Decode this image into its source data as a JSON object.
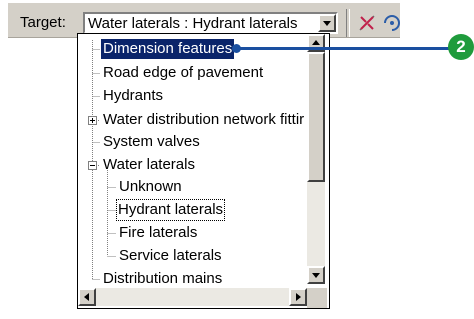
{
  "toolbar": {
    "target_label": "Target:",
    "target_value": "Water laterals : Hydrant laterals",
    "tools": [
      "sketch-tool-icon",
      "trace-tool-icon"
    ]
  },
  "tree": {
    "items": [
      {
        "label": "Dimension features",
        "state": "selected"
      },
      {
        "label": "Road  edge of pavement"
      },
      {
        "label": "Hydrants"
      },
      {
        "label": "Water distribution network fittir",
        "expander": "collapsed"
      },
      {
        "label": "System valves"
      },
      {
        "label": "Water laterals",
        "expander": "expanded"
      },
      {
        "label": "Unknown"
      },
      {
        "label": "Hydrant laterals",
        "state": "focused"
      },
      {
        "label": "Fire laterals"
      },
      {
        "label": "Service laterals"
      },
      {
        "label": "Distribution mains"
      }
    ]
  },
  "callout": {
    "number": "2",
    "color": "#1f9b3c",
    "line_color": "#1a4fa0"
  },
  "colors": {
    "selection": "#0a246a",
    "chrome": "#d4d0c8"
  }
}
